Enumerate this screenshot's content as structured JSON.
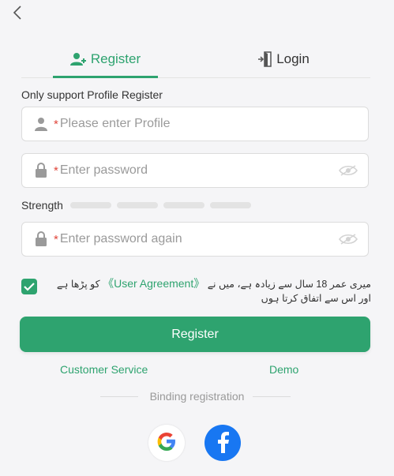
{
  "tabs": {
    "register_label": "Register",
    "login_label": "Login"
  },
  "form": {
    "subtitle": "Only support Profile Register",
    "required_mark": "*",
    "profile_placeholder": "Please enter Profile",
    "password_placeholder": "Enter password",
    "confirm_placeholder": "Enter password again",
    "strength_label": "Strength"
  },
  "agreement": {
    "checked": true,
    "text_before": "میری عمر 18 سال سے زیادہ ہے، میں نے ",
    "link": "《User Agreement》",
    "text_after": " کو پڑھا ہے اور اس سے اتفاق کرتا ہوں"
  },
  "actions": {
    "register_button": "Register",
    "customer_service": "Customer Service",
    "demo": "Demo",
    "binding_registration": "Binding registration"
  },
  "social": {
    "google_icon": "google-icon",
    "facebook_icon": "facebook-icon"
  },
  "colors": {
    "accent": "#2ea36f",
    "required": "#e0453a",
    "facebook": "#1877f2"
  }
}
